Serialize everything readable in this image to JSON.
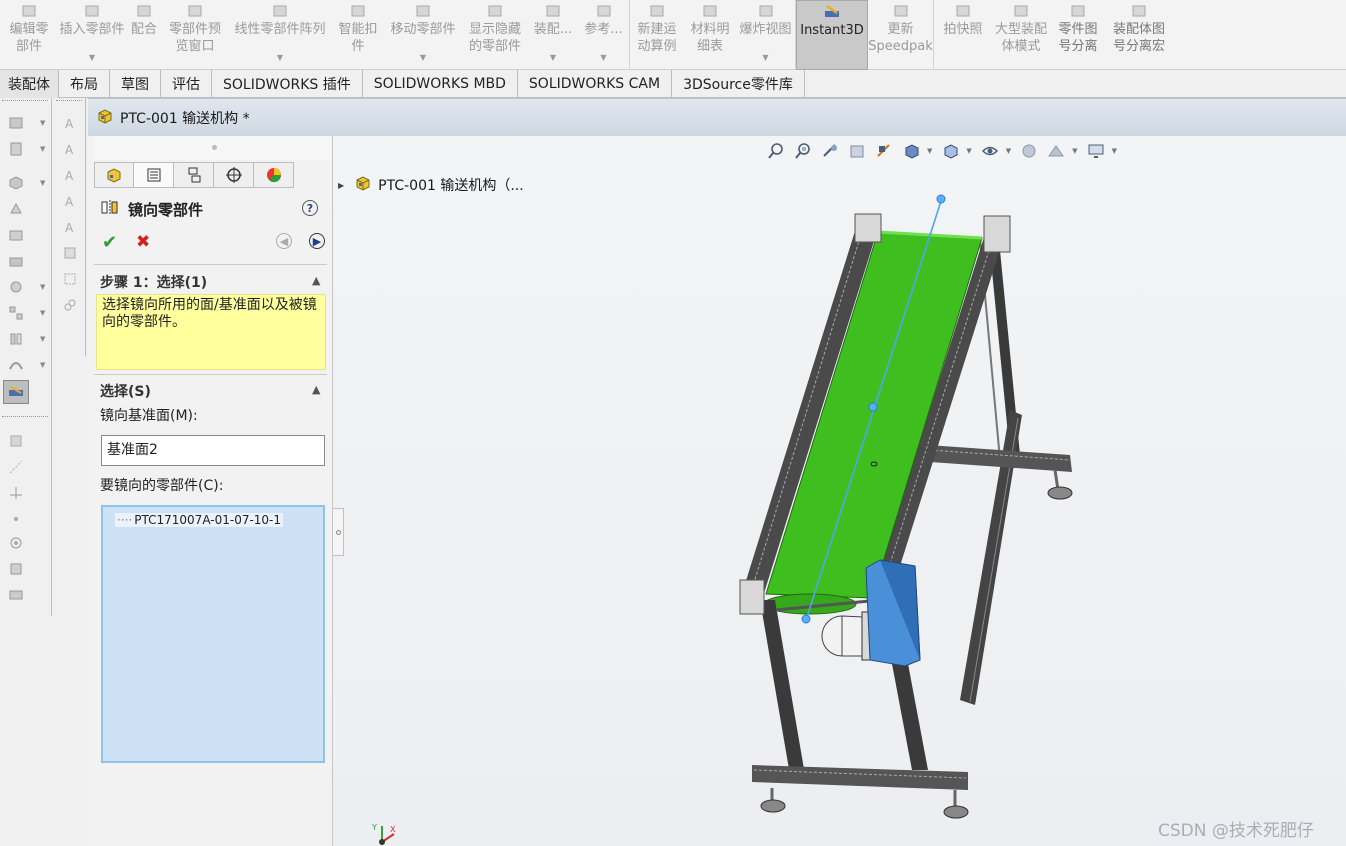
{
  "ribbon": [
    {
      "label": "编辑零\n部件",
      "icon": "edit-component-icon",
      "dropdown": false
    },
    {
      "label": "插入零部件",
      "icon": "insert-component-icon",
      "dropdown": true
    },
    {
      "label": "配合",
      "icon": "mate-icon",
      "dropdown": false
    },
    {
      "label": "零部件预\n览窗口",
      "icon": "preview-window-icon",
      "dropdown": false
    },
    {
      "label": "线性零部件阵列",
      "icon": "linear-pattern-icon",
      "dropdown": true
    },
    {
      "label": "智能扣\n件",
      "icon": "smart-fastener-icon",
      "dropdown": false
    },
    {
      "label": "移动零部件",
      "icon": "move-component-icon",
      "dropdown": true
    },
    {
      "label": "显示隐藏\n的零部件",
      "icon": "show-hidden-icon",
      "dropdown": false
    },
    {
      "label": "装配...",
      "icon": "assembly-feature-icon",
      "dropdown": true
    },
    {
      "label": "参考...",
      "icon": "reference-geometry-icon",
      "dropdown": true
    },
    {
      "label": "新建运\n动算例",
      "icon": "motion-study-icon",
      "dropdown": false
    },
    {
      "label": "材料明\n细表",
      "icon": "bom-icon",
      "dropdown": false
    },
    {
      "label": "爆炸视图",
      "icon": "exploded-view-icon",
      "dropdown": true
    },
    {
      "label": "Instant3D",
      "icon": "instant3d-icon",
      "dropdown": false
    },
    {
      "label": "更新\nSpeedpak",
      "icon": "speedpak-icon",
      "dropdown": false
    },
    {
      "label": "拍快照",
      "icon": "snapshot-icon",
      "dropdown": false
    },
    {
      "label": "大型装配\n体模式",
      "icon": "large-assembly-icon",
      "dropdown": false
    },
    {
      "label": "零件图\n号分离",
      "icon": "part-number-icon",
      "dropdown": false
    },
    {
      "label": "装配体图\n号分离宏",
      "icon": "assembly-macro-icon",
      "dropdown": false
    }
  ],
  "tabs": [
    "装配体",
    "布局",
    "草图",
    "评估",
    "SOLIDWORKS 插件",
    "SOLIDWORKS MBD",
    "SOLIDWORKS CAM",
    "3DSource零件库"
  ],
  "document": {
    "title": "PTC-001 输送机构 *"
  },
  "feature_tree": {
    "root": "PTC-001 输送机构（..."
  },
  "property_manager": {
    "title": "镜向零部件",
    "help": "?",
    "step1": {
      "title": "步骤 1：选择(1)",
      "message": "选择镜向所用的面/基准面以及被镜向的零部件。"
    },
    "selections": {
      "title": "选择(S)",
      "mirror_plane_label": "镜向基准面(M):",
      "mirror_plane_value": "基准面2",
      "components_label": "要镜向的零部件(C):",
      "components": [
        "PTC171007A-01-07-10-1"
      ]
    }
  },
  "watermark": "CSDN @技术死肥仔",
  "colors": {
    "belt": "#3fbf1f",
    "motor_box": "#4a90d8",
    "viewport_bg": "#eef0f2",
    "message_bg": "#ffff9e"
  }
}
